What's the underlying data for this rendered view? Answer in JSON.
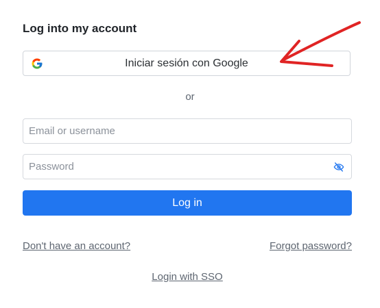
{
  "header": {
    "title": "Log into my account"
  },
  "google_button": {
    "label": "Iniciar sesión con Google",
    "icon": "google-icon"
  },
  "divider": {
    "text": "or"
  },
  "form": {
    "email_placeholder": "Email or username",
    "email_value": "",
    "password_placeholder": "Password",
    "password_value": "",
    "password_toggle_icon": "eye-slash-icon",
    "submit_label": "Log in"
  },
  "links": {
    "no_account": "Don't have an account?",
    "forgot_password": "Forgot password?",
    "sso": "Login with SSO"
  },
  "colors": {
    "primary": "#2176f0",
    "annotation": "#e02424"
  }
}
